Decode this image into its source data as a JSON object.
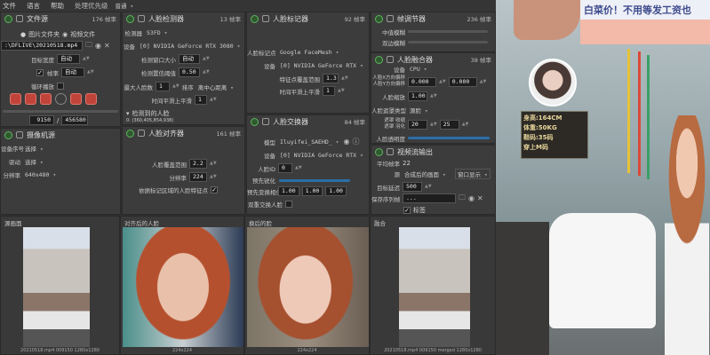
{
  "menu": {
    "file": "文件",
    "language": "语言",
    "help": "帮助",
    "priority_label": "处理优先级",
    "priority_value": "普通"
  },
  "file_source": {
    "title": "文件源",
    "fps": "176 帧率",
    "radio_folder": "图片文件夹",
    "radio_video": "视频文件",
    "path": ":\\DFLIVE\\20210518.mp4",
    "target_width_label": "目标宽度",
    "target_width": "自动",
    "fps_label": "帧率",
    "fps_value": "自动",
    "loop_label": "循环播放",
    "frame_current": "9150",
    "frame_total": "456580"
  },
  "camera_source": {
    "title": "摄像机源",
    "device_label": "设备序号",
    "device": "选择",
    "driver_label": "驱动",
    "driver": "选择",
    "res_label": "分辨率",
    "res": "640x480"
  },
  "face_detector": {
    "title": "人脸检测器",
    "fps": "13 帧率",
    "detector_label": "检测器",
    "detector": "S3FD",
    "device_label": "设备",
    "device": "[0] NVIDIA GeForce RTX 3080",
    "window_label": "检测窗口大小",
    "window": "自动",
    "threshold_label": "检测置信阈值",
    "threshold": "0.50",
    "max_faces_label": "最大人脸数",
    "max_faces": "1",
    "sort_label": "排序",
    "sort": "离中心距离",
    "smooth_label": "时间平滑上平滑",
    "smooth": "1",
    "detected_label": "检测到的人脸",
    "detected_coords": "0: (360,405,854,938)"
  },
  "face_aligner": {
    "title": "人脸对齐器",
    "fps": "161 帧率",
    "coverage_label": "人脸覆盖范围",
    "coverage": "2.2",
    "res_label": "分辨率",
    "res": "224",
    "landmarks_label": "依据标记区域的人脸特征点"
  },
  "face_marker": {
    "title": "人脸标记器",
    "fps": "92 帧率",
    "marker_label": "人脸标记点",
    "marker": "Google FaceMesh",
    "device_label": "设备",
    "device": "[0] NVIDIA GeForce RTX",
    "coverage_label": "特征点覆盖范围",
    "coverage": "1.3",
    "smooth_label": "时间平滑上平滑",
    "smooth": "1"
  },
  "face_swapper": {
    "title": "人脸交换器",
    "fps": "84 帧率",
    "model_label": "模型",
    "model": "Iluyifei_SAEHD_",
    "device_label": "设备",
    "device": "[0] NVIDIA GeForce RTX",
    "face_id_label": "人脸ID",
    "face_id": "0",
    "presharpen_label": "预先锐化",
    "morph_label": "预先变换相位",
    "morph": [
      "1.00",
      "1.00",
      "1.00"
    ],
    "two_pass_label": "双重交换人脸"
  },
  "frame_adjuster": {
    "title": "帧调节器",
    "fps": "236 帧率",
    "median_label": "中值模糊",
    "bilateral_label": "双边模糊"
  },
  "face_merger": {
    "title": "人脸融合器",
    "fps": "38 帧率",
    "device_label": "设备",
    "device": "CPU",
    "x_label": "人脸X方向偏移",
    "y_label": "人脸Y方向偏移",
    "x": "0.000",
    "y": "0.000",
    "scale_label": "人脸缩放",
    "scale": "1.00",
    "mask_label": "人脸遮罩类型",
    "mask": "源脸",
    "erode_label": "遮罩 收缩",
    "blur_label": "遮罩 羽化",
    "erode": "20",
    "blur": "25",
    "opacity_label": "人脸透明度"
  },
  "stream_output": {
    "title": "视频流输出",
    "avg_fps_label": "平均帧率",
    "avg_fps": "22",
    "source_label": "源",
    "source": "合成后的画面",
    "window_btn": "窗口显示",
    "delay_label": "目标延迟",
    "delay": "500",
    "save_label": "保存序列帧",
    "save_path": "...",
    "tag_label": "标签"
  },
  "previews": [
    {
      "title": "源画面",
      "caption": "20210518.mp4 009150 1280x1280"
    },
    {
      "title": "对齐后的人脸",
      "caption": "224x224"
    },
    {
      "title": "换后的脸",
      "caption": "224x224"
    },
    {
      "title": "融合",
      "caption": "20210518.mp4 009150 merged 1280x1280"
    }
  ],
  "photo": {
    "banner": "白菜价！不用等发工资也",
    "sign": [
      "身高:164CM",
      "体重:50KG",
      "鞋码:35码",
      "穿上M码"
    ]
  }
}
